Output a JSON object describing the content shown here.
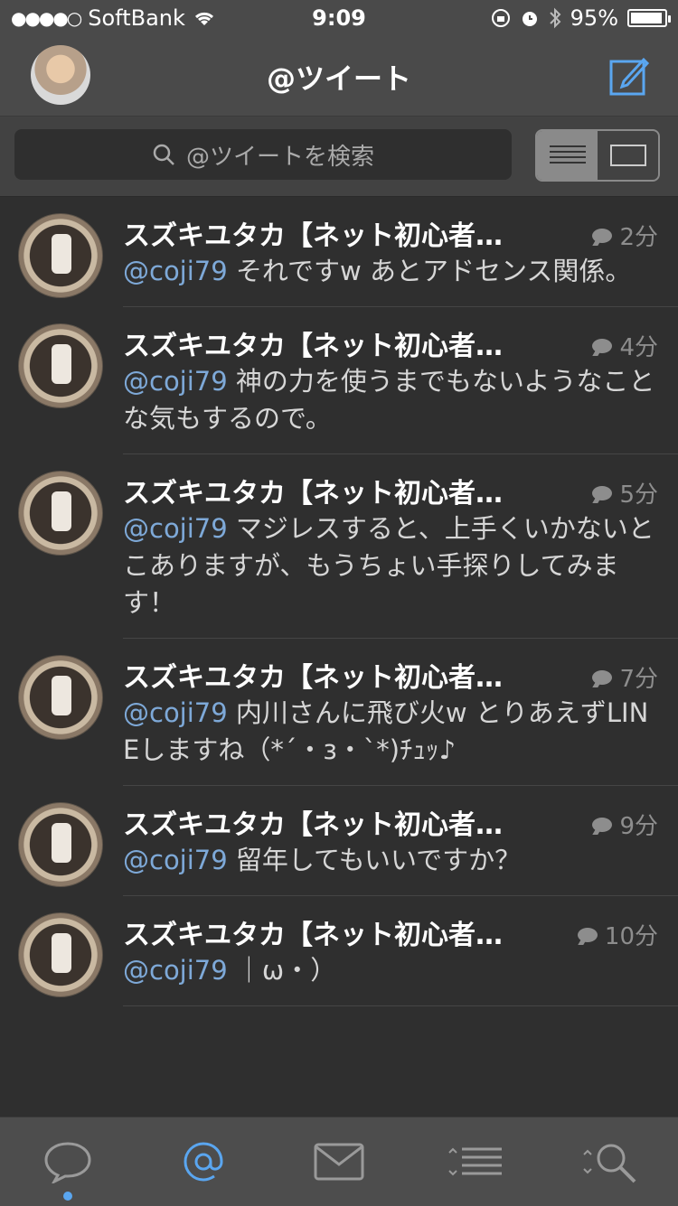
{
  "status": {
    "carrier": "SoftBank",
    "time": "9:09",
    "battery": "95%",
    "battery_level": 0.95
  },
  "nav": {
    "title": "@ツイート"
  },
  "search": {
    "placeholder": "@ツイートを検索"
  },
  "tweets": [
    {
      "name": "スズキユタカ【ネット初心者…",
      "time": "2分",
      "mention": "@coji79",
      "text": " それですw あとアドセンス関係。"
    },
    {
      "name": "スズキユタカ【ネット初心者…",
      "time": "4分",
      "mention": "@coji79",
      "text": " 神の力を使うまでもないようなことな気もするので。"
    },
    {
      "name": "スズキユタカ【ネット初心者…",
      "time": "5分",
      "mention": "@coji79",
      "text": " マジレスすると、上手くいかないとこありますが、もうちょい手探りしてみます！"
    },
    {
      "name": "スズキユタカ【ネット初心者…",
      "time": "7分",
      "mention": "@coji79",
      "text": " 内川さんに飛び火w とりあえずLINEしますね（*´・з・`*)ﾁｭｯ♪"
    },
    {
      "name": "スズキユタカ【ネット初心者…",
      "time": "9分",
      "mention": "@coji79",
      "text": " 留年してもいいですか？"
    },
    {
      "name": "スズキユタカ【ネット初心者…",
      "time": "10分",
      "mention": "@coji79",
      "text": " ｜ω・）"
    }
  ],
  "tabs": [
    {
      "icon": "speech-bubble-icon",
      "active": false
    },
    {
      "icon": "at-sign-icon",
      "active": true
    },
    {
      "icon": "envelope-icon",
      "active": false
    },
    {
      "icon": "list-icon",
      "active": false
    },
    {
      "icon": "search-icon",
      "active": false
    }
  ],
  "colors": {
    "accent": "#5aa6f0",
    "mention": "#7ea9d8",
    "background": "#2f2f2f"
  }
}
